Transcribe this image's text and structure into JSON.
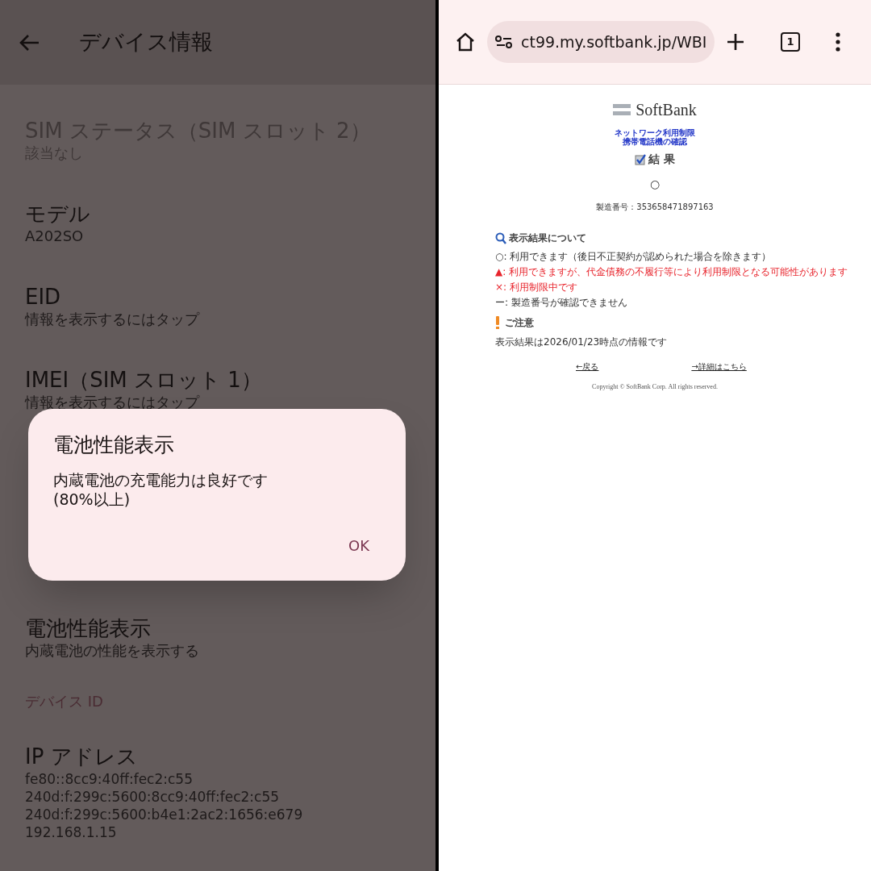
{
  "settings": {
    "title": "デバイス情報",
    "items": [
      {
        "title": "SIM ステータス（SIM スロット 2）",
        "lines": [
          "該当なし"
        ],
        "disabled": true
      },
      {
        "title": "モデル",
        "lines": [
          "A202SO"
        ],
        "disabled": false
      },
      {
        "title": "EID",
        "lines": [
          "情報を表示するにはタップ"
        ],
        "disabled": false
      },
      {
        "title": "IMEI（SIM スロット 1）",
        "lines": [
          "情報を表示するにはタップ"
        ],
        "disabled": false
      },
      {
        "title": "電池性能表示",
        "lines": [
          "内蔵電池の性能を表示する"
        ],
        "disabled": false
      }
    ],
    "section": "デバイス ID",
    "ip": {
      "title": "IP アドレス",
      "lines": [
        "fe80::8cc9:40ff:fec2:c55",
        "240d:f:299c:5600:8cc9:40ff:fec2:c55",
        "240d:f:299c:5600:b4e1:2ac2:1656:e679",
        "192.168.1.15"
      ]
    }
  },
  "dialog": {
    "title": "電池性能表示",
    "message": "内蔵電池の充電能力は良好です\n(80%以上)",
    "button": "OK"
  },
  "browser": {
    "url": "ct99.my.softbank.jp/WBI",
    "tab_count": "1"
  },
  "page": {
    "logo": "SoftBank",
    "heading": [
      "ネットワーク利用制限",
      "携帯電話機の確認"
    ],
    "result_label": "結 果",
    "result": "○",
    "serial": "製造番号：353658471897163",
    "legend_title": "表示結果について",
    "legend": [
      {
        "text": "○: 利用できます（後日不正契約が認められた場合を除きます）",
        "color": "#333333"
      },
      {
        "text": "▲: 利用できますが、代金債務の不履行等により利用制限となる可能性があります",
        "color": "#e8242c"
      },
      {
        "text": "×: 利用制限中です",
        "color": "#e8242c"
      },
      {
        "text": "ー: 製造番号が確認できません",
        "color": "#333333"
      }
    ],
    "notice_title": "ご注意",
    "notice": "表示結果は2026/01/23時点の情報です",
    "links": [
      "←戻る",
      "→詳細はこちら"
    ],
    "copyright": "Copyright © SoftBank Corp. All rights reserved."
  }
}
